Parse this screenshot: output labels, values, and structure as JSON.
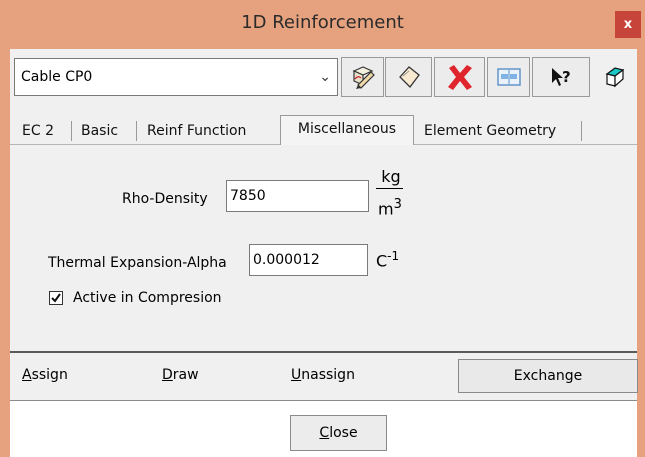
{
  "window": {
    "title": "1D Reinforcement",
    "close_label": "x"
  },
  "header": {
    "combo_value": "Cable CP0",
    "toolbar_icons": [
      "edit-pencil-icon",
      "eraser-icon",
      "delete-x-icon",
      "properties-icon",
      "whats-this-help-icon",
      "eraser-3d-icon"
    ]
  },
  "tabs": [
    {
      "label": "EC 2"
    },
    {
      "label": "Basic"
    },
    {
      "label": "Reinf Function"
    },
    {
      "label": "Miscellaneous",
      "active": true
    },
    {
      "label": "Element Geometry"
    }
  ],
  "fields": {
    "rho_label": "Rho-Density",
    "rho_value": "7850",
    "rho_unit_num": "kg",
    "rho_unit_den": "m",
    "rho_unit_exp": "3",
    "alpha_label": "Thermal Expansion-Alpha",
    "alpha_value": "0.000012",
    "alpha_unit": "C",
    "alpha_unit_exp": "-1"
  },
  "options": {
    "active_compression_label": "Active in Compresion",
    "active_compression_checked": true
  },
  "actions": {
    "assign_mnemonic": "A",
    "assign_rest": "ssign",
    "draw_mnemonic": "D",
    "draw_rest": "raw",
    "unassign_mnemonic": "U",
    "unassign_rest": "nassign",
    "exchange": "Exchange"
  },
  "footer": {
    "close_mnemonic": "C",
    "close_rest": "lose"
  }
}
